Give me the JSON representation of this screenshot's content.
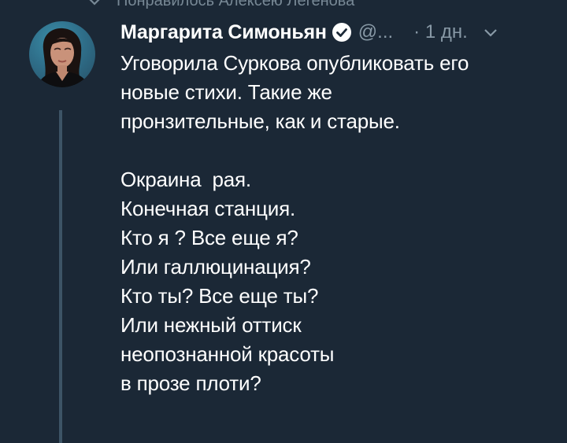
{
  "top_context": {
    "text": "Понравилось Алексею Легенова"
  },
  "tweet": {
    "author_name": "Маргарита Симоньян",
    "handle": "@...",
    "time": "· 1 дн.",
    "paragraph1": [
      "Уговорила Суркова опубликовать его",
      "новые стихи. Такие же",
      "пронзительные, как и старые."
    ],
    "poem": [
      "Окраина  рая.",
      "Конечная станция.",
      "Кто я ? Все еще я?",
      "Или галлюцинация?",
      "Кто ты? Все еще ты?",
      "Или нежный оттиск",
      "неопознанной красоты",
      "в прозе плоти?"
    ]
  },
  "icons": {
    "verified": "verified-badge-icon",
    "caret": "chevron-down-icon",
    "context": "chevron-icon"
  },
  "colors": {
    "background": "#1b2836",
    "text": "#ffffff",
    "secondary": "#8899a6",
    "thread_line": "#3d5466"
  }
}
